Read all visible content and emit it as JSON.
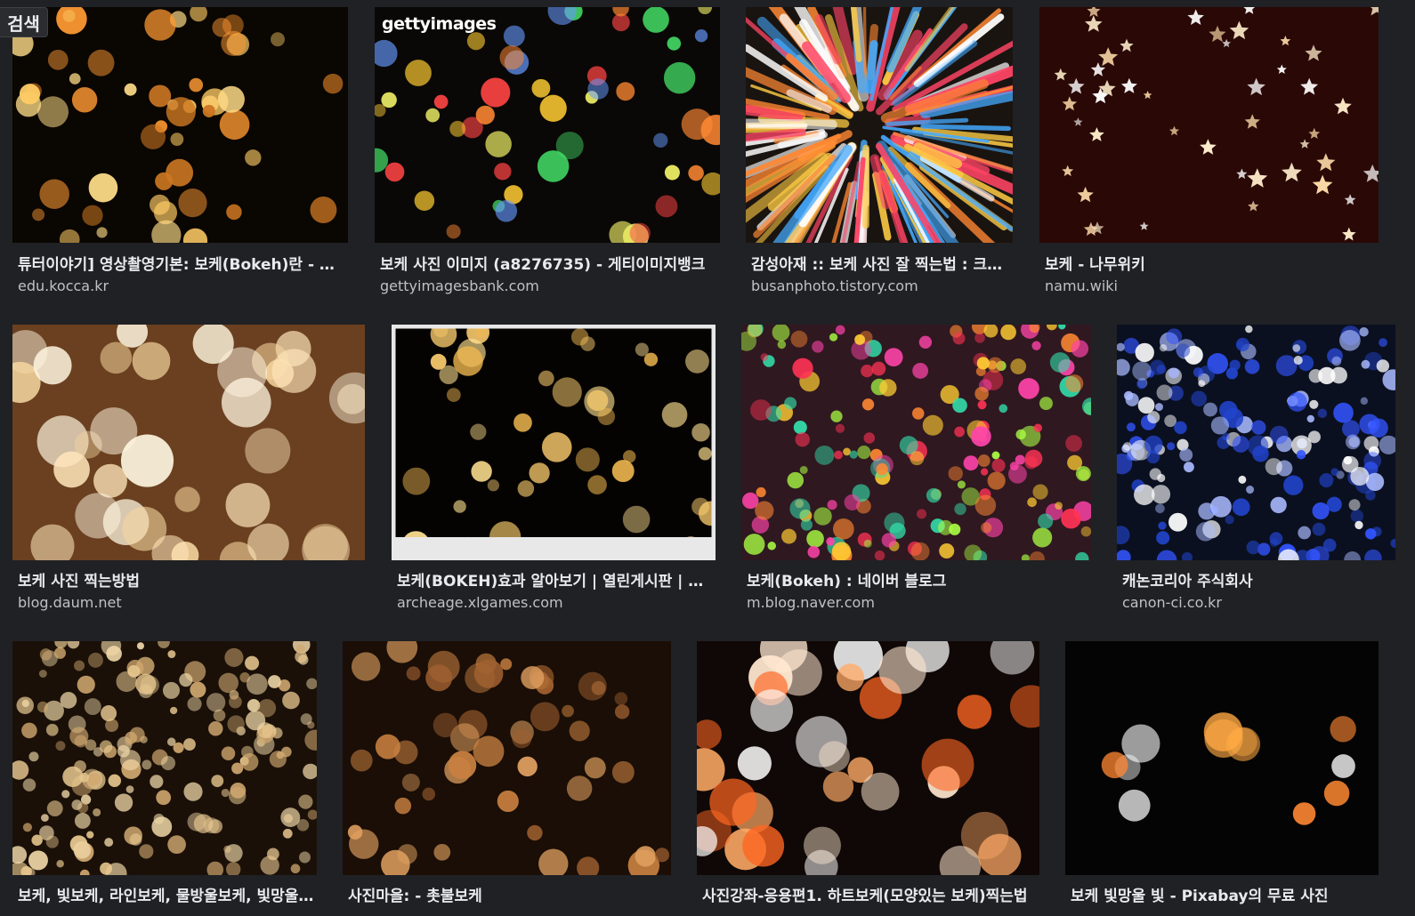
{
  "header": {
    "search_label": "검색"
  },
  "results": [
    {
      "title": "튜터이야기] 영상촬영기본: 보케(Bokeh)란 - 콘텐...",
      "source": "edu.kocca.kr",
      "palette": [
        "#ffcc66",
        "#ff9933",
        "#ffdd88",
        "#cc7722"
      ],
      "bg": "#0a0602",
      "style": "dots"
    },
    {
      "title": "보케 사진 이미지 (a8276735) - 게티이미지뱅크",
      "source": "gettyimagesbank.com",
      "palette": [
        "#ff4444",
        "#ffcc33",
        "#44dd66",
        "#6699ff",
        "#ff8833",
        "#eeee66"
      ],
      "bg": "#0a0806",
      "style": "dots",
      "watermark": "gettyimages"
    },
    {
      "title": "감성아재 :: 보케 사진 잘 찍는법 : 크리...",
      "source": "busanphoto.tistory.com",
      "palette": [
        "#ffffff",
        "#ff8833",
        "#44aaff",
        "#ffcc44",
        "#ff4466"
      ],
      "bg": "#1a1410",
      "style": "burst"
    },
    {
      "title": "보케 - 나무위키",
      "source": "namu.wiki",
      "palette": [
        "#ffeecc",
        "#ffddaa",
        "#ffffff"
      ],
      "bg": "#2a0806",
      "style": "stars"
    },
    {
      "title": "보케 사진 찍는방법",
      "source": "blog.daum.net",
      "palette": [
        "#fff6e0",
        "#ffe6bb",
        "#f5d6a0"
      ],
      "bg": "#6a4020",
      "style": "bigdots"
    },
    {
      "title": "보케(BOKEH)효과 알아보기 | 열린게시판 | 아키...",
      "source": "archeage.xlgames.com",
      "palette": [
        "#ffd070",
        "#ffe090",
        "#f0b850"
      ],
      "bg": "#050302",
      "style": "dots",
      "frame": true
    },
    {
      "title": "보케(Bokeh) : 네이버 블로그",
      "source": "m.blog.naver.com",
      "palette": [
        "#ff3355",
        "#ffcc33",
        "#33ddaa",
        "#ff8833",
        "#aaff44",
        "#ff44aa"
      ],
      "bg": "#301820",
      "style": "dense"
    },
    {
      "title": "캐논코리아 주식회사",
      "source": "canon-ci.co.kr",
      "palette": [
        "#3355ff",
        "#ffffff",
        "#2244cc",
        "#aabbff"
      ],
      "bg": "#0a1020",
      "style": "dense"
    },
    {
      "title": "보케, 빛보케, 라인보케, 물방울보케, 빛망울, ...",
      "source": "",
      "palette": [
        "#e8c890",
        "#f0d8a8",
        "#d0a870"
      ],
      "bg": "#1a1008",
      "style": "dense"
    },
    {
      "title": "사진마을: - 촛불보케",
      "source": "",
      "palette": [
        "#c88040",
        "#e0a060",
        "#a06030"
      ],
      "bg": "#1a0e06",
      "style": "dots"
    },
    {
      "title": "사진강좌-응용편1. 하트보케(모양있는 보케)찍는법",
      "source": "",
      "palette": [
        "#ffe8d0",
        "#ff6622",
        "#ffaa66",
        "#ffffff"
      ],
      "bg": "#100806",
      "style": "bigdots"
    },
    {
      "title": "보케 빛망울 빛 - Pixabay의 무료 사진",
      "source": "",
      "palette": [
        "#ffaa44",
        "#ffffff",
        "#ff8833"
      ],
      "bg": "#050404",
      "style": "sparse"
    }
  ]
}
